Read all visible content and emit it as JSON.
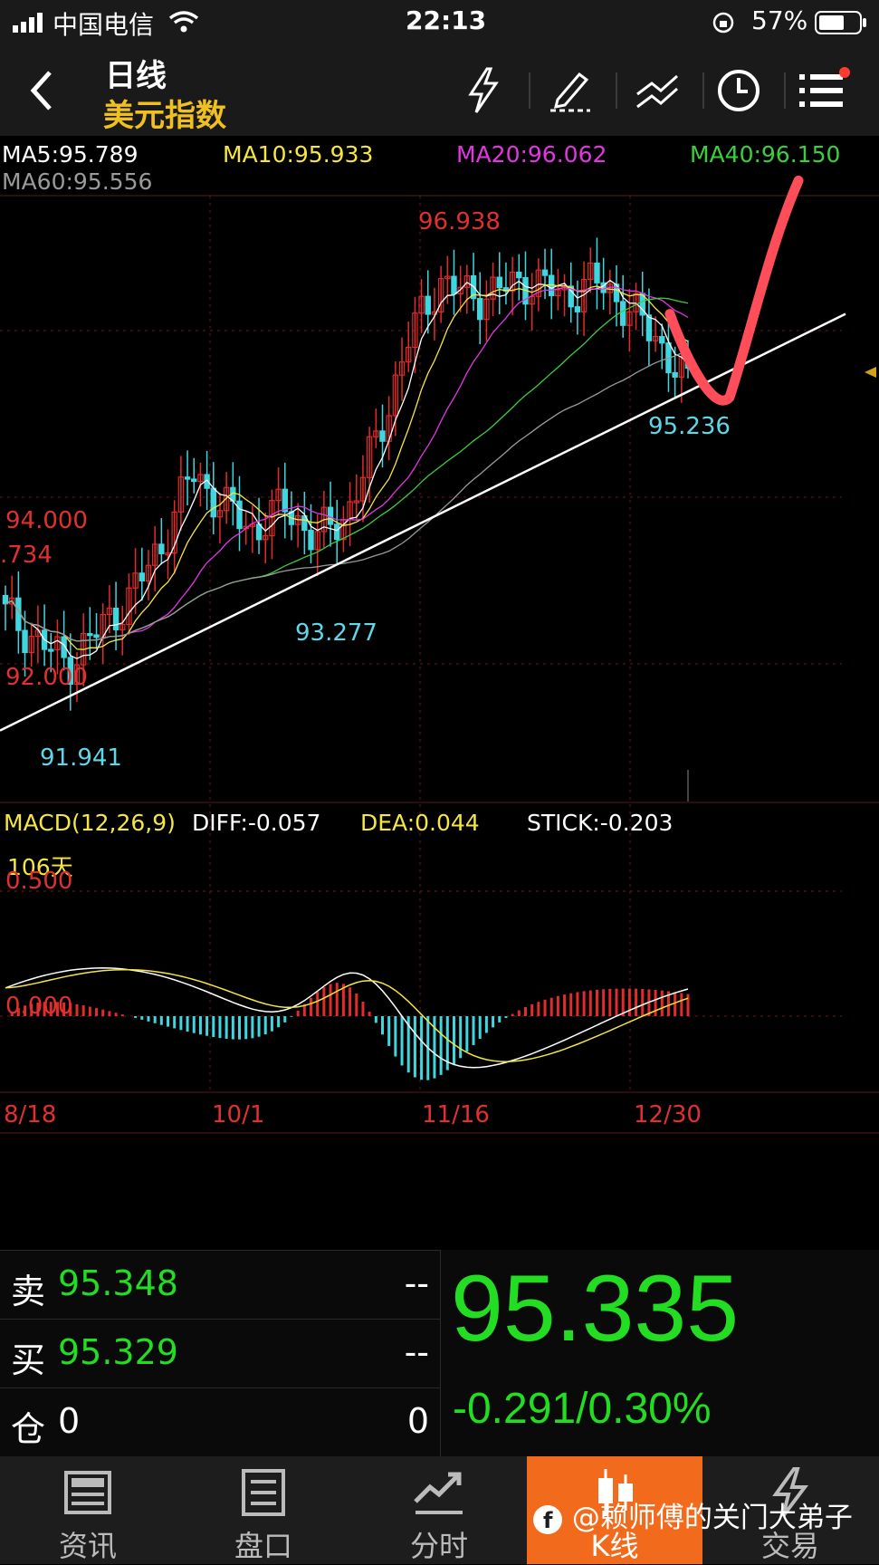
{
  "status_bar": {
    "carrier": "中国电信",
    "time": "22:13",
    "battery": "57%"
  },
  "header": {
    "period": "日线",
    "instrument": "美元指数",
    "colors": {
      "period": "#ffffff",
      "instrument": "#f0c020"
    }
  },
  "toolbar_icons": [
    "back-icon",
    "lightning-icon",
    "draw-pen-icon",
    "trend-lines-icon",
    "clock-icon",
    "menu-icon"
  ],
  "ma_legend": [
    {
      "label": "MA5:95.789",
      "color": "#ffffff"
    },
    {
      "label": "MA10:95.933",
      "color": "#f5e642"
    },
    {
      "label": "MA20:96.062",
      "color": "#e236e2"
    },
    {
      "label": "MA40:96.150",
      "color": "#3ccf3c"
    },
    {
      "label": "MA60:95.556",
      "color": "#9a9a9a"
    }
  ],
  "price_axis_labels": [
    "94.000",
    "92.000",
    ".734"
  ],
  "annotations": {
    "high": "96.938",
    "low_mid": "93.277",
    "low_left": "91.941",
    "recent_low": "95.236",
    "days": "106天"
  },
  "macd_header": {
    "name": "MACD(12,26,9)",
    "diff": "DIFF:-0.057",
    "dea": "DEA:0.044",
    "stick": "STICK:-0.203"
  },
  "macd_axis_labels": [
    "0.500",
    "0.000"
  ],
  "date_labels": [
    "8/18",
    "10/1",
    "11/16",
    "12/30"
  ],
  "quote": {
    "sell_label": "卖",
    "sell_price": "95.348",
    "sell_vol": "--",
    "buy_label": "买",
    "buy_price": "95.329",
    "buy_vol": "--",
    "pos_label": "仓",
    "pos_left": "0",
    "pos_right": "0",
    "last_price": "95.335",
    "change": "-0.291/0.30%"
  },
  "tabs": [
    {
      "label": "资讯",
      "icon": "news-icon"
    },
    {
      "label": "盘口",
      "icon": "order-book-icon"
    },
    {
      "label": "分时",
      "icon": "intraday-icon"
    },
    {
      "label": "K线",
      "icon": "candlestick-icon"
    },
    {
      "label": "交易",
      "icon": "trade-icon"
    }
  ],
  "active_tab": "K线",
  "watermark": "@赖师傅的关门大弟子",
  "chart_data": {
    "type": "candlestick",
    "instrument": "美元指数",
    "period": "日线",
    "x_date_ticks": [
      "8/18",
      "10/1",
      "11/16",
      "12/30"
    ],
    "price_axis_ticks": [
      92.0,
      94.0
    ],
    "marked_values": {
      "high": 96.938,
      "lows": [
        91.941,
        93.277,
        95.236
      ]
    },
    "close_path": [
      92.6,
      92.3,
      92.0,
      92.4,
      92.8,
      93.4,
      94.3,
      93.9,
      93.6,
      93.9,
      93.5,
      93.8,
      94.7,
      95.9,
      96.6,
      96.4,
      96.5,
      96.6,
      96.4,
      96.6,
      96.3,
      95.9,
      95.335
    ],
    "ma_last": {
      "MA5": 95.789,
      "MA10": 95.933,
      "MA20": 96.062,
      "MA40": 96.15,
      "MA60": 95.556
    },
    "macd": {
      "params": "12,26,9",
      "diff": -0.057,
      "dea": 0.044,
      "stick": -0.203,
      "ylabels": [
        0.5,
        0.0
      ]
    }
  }
}
